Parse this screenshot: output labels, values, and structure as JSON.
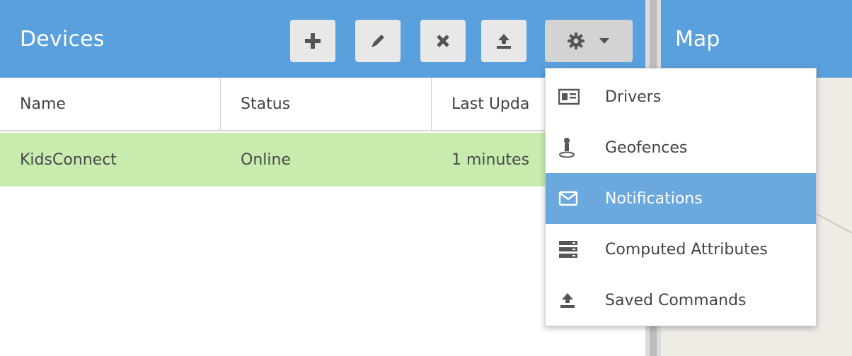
{
  "devices": {
    "title": "Devices",
    "columns": [
      "Name",
      "Status",
      "Last Upda"
    ],
    "rows": [
      {
        "name": "KidsConnect",
        "status": "Online",
        "last_update": "1 minutes"
      }
    ]
  },
  "toolbar": {
    "add_icon": "plus-icon",
    "edit_icon": "pencil-icon",
    "remove_icon": "cross-icon",
    "command_icon": "upload-icon",
    "settings_icon": "gear-icon"
  },
  "map": {
    "title": "Map"
  },
  "menu": {
    "items": [
      {
        "label": "Drivers",
        "icon": "id-card-icon"
      },
      {
        "label": "Geofences",
        "icon": "map-pin-icon"
      },
      {
        "label": "Notifications",
        "icon": "envelope-icon",
        "active": true
      },
      {
        "label": "Computed Attributes",
        "icon": "server-icon"
      },
      {
        "label": "Saved Commands",
        "icon": "upload-icon"
      }
    ]
  },
  "colors": {
    "header_blue": "#5aa0dc",
    "selected_row": "#c7ecad",
    "menu_active": "#6aa8de"
  }
}
